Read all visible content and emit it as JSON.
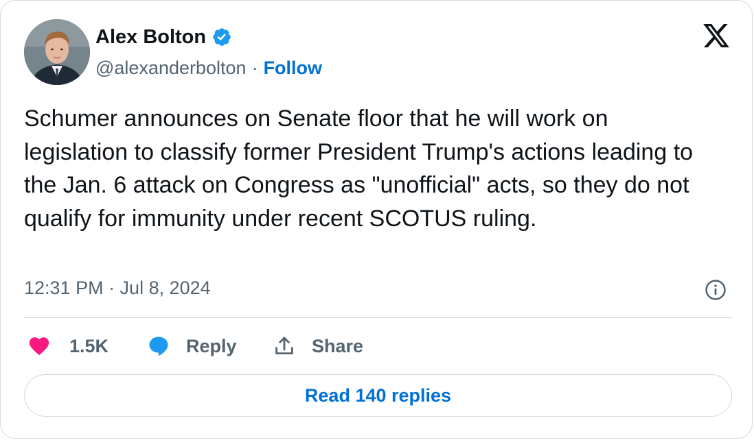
{
  "author": {
    "name": "Alex Bolton",
    "handle": "@alexanderbolton",
    "separator": "·",
    "follow_label": "Follow",
    "verified_icon": "verified-badge-icon",
    "avatar_icon": "profile-photo"
  },
  "tweet": {
    "text": "Schumer announces on Senate floor that he will work on legislation to classify former President Trump's actions leading to the Jan. 6 attack on Congress as \"unofficial\" acts, so they do not qualify for immunity under recent SCOTUS ruling.",
    "timestamp": "12:31 PM · Jul 8, 2024"
  },
  "actions": {
    "like_count": "1.5K",
    "reply_label": "Reply",
    "share_label": "Share"
  },
  "read_replies_label": "Read 140 replies",
  "colors": {
    "accent": "#006fd6",
    "verified": "#1d9bf0",
    "like": "#f91880",
    "text_primary": "#0f1419",
    "text_secondary": "#536471",
    "border": "#cfd9de"
  }
}
